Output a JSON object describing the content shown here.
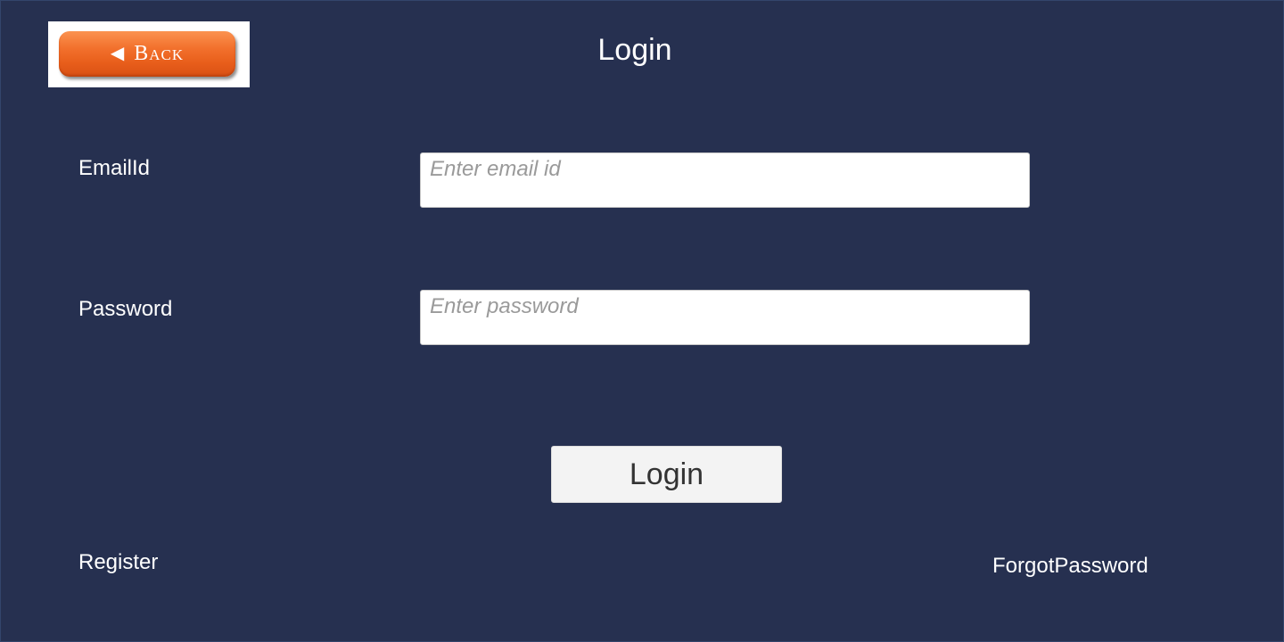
{
  "header": {
    "title": "Login",
    "back_label": "Back",
    "back_arrow": "◀"
  },
  "form": {
    "email": {
      "label": "EmailId",
      "placeholder": "Enter email id",
      "value": ""
    },
    "password": {
      "label": "Password",
      "placeholder": "Enter password",
      "value": ""
    },
    "submit_label": "Login"
  },
  "links": {
    "register": "Register",
    "forgot_password": "ForgotPassword"
  },
  "colors": {
    "background": "#263050",
    "back_button": "#f2702c",
    "text": "#ffffff",
    "button_face": "#f3f3f3"
  }
}
